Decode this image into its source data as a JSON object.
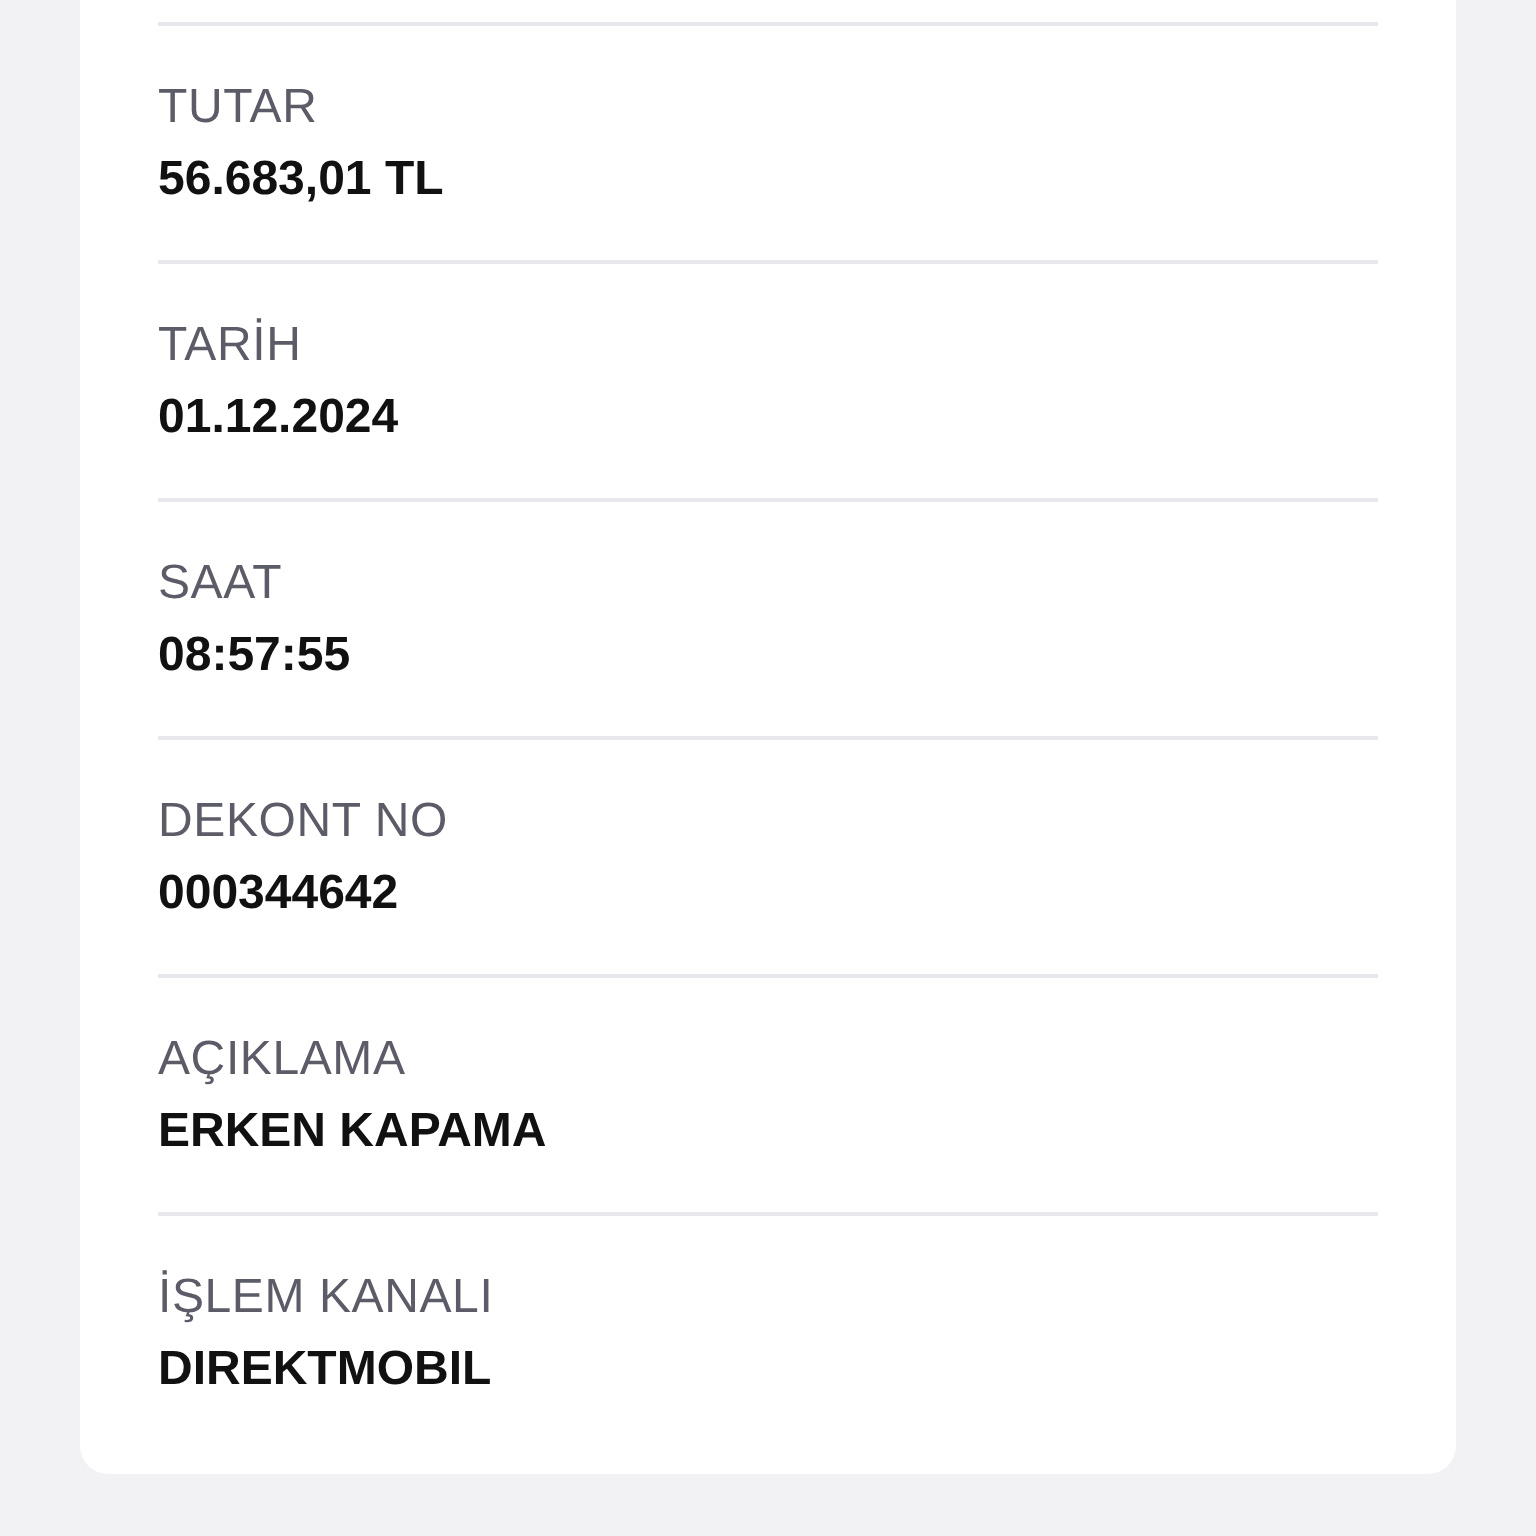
{
  "details": [
    {
      "label": "TUTAR",
      "value": "56.683,01 TL"
    },
    {
      "label": "TARİH",
      "value": "01.12.2024"
    },
    {
      "label": "SAAT",
      "value": "08:57:55"
    },
    {
      "label": "DEKONT NO",
      "value": "000344642"
    },
    {
      "label": "AÇIKLAMA",
      "value": "ERKEN KAPAMA"
    },
    {
      "label": "İŞLEM KANALI",
      "value": "DIREKTMOBIL"
    }
  ]
}
